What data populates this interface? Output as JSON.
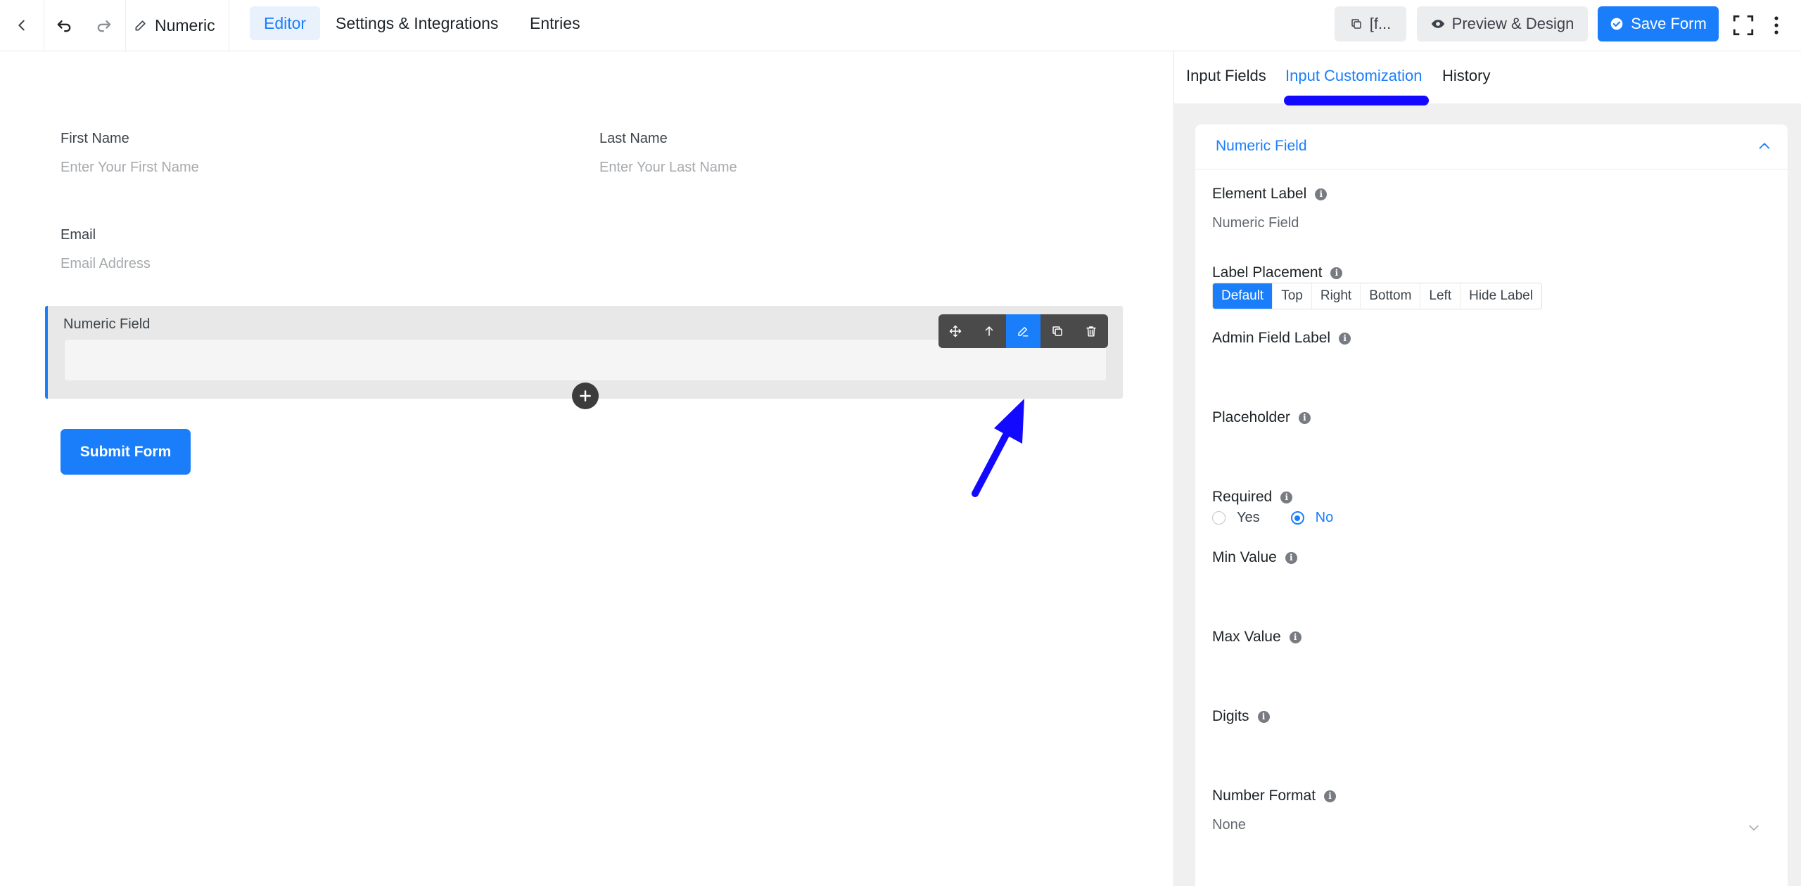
{
  "header": {
    "form_title": "Numeric",
    "tabs": [
      "Editor",
      "Settings & Integrations",
      "Entries"
    ],
    "shortcode_label": "[f...",
    "preview_label": "Preview & Design",
    "save_label": "Save Form"
  },
  "editor": {
    "first_name": {
      "label": "First Name",
      "placeholder": "Enter Your First Name"
    },
    "last_name": {
      "label": "Last Name",
      "placeholder": "Enter Your Last Name"
    },
    "email": {
      "label": "Email",
      "placeholder": "Email Address"
    },
    "numeric": {
      "label": "Numeric Field"
    },
    "submit_label": "Submit Form",
    "toolbar_icons": [
      "move-icon",
      "arrow-up-icon",
      "pencil-icon",
      "copy-icon",
      "trash-icon"
    ],
    "accent_color": "#1a7efb",
    "arrow_color": "#1409ff"
  },
  "panel": {
    "tabs": [
      "Input Fields",
      "Input Customization",
      "History"
    ],
    "active_tab": "Input Customization",
    "section_title": "Numeric Field",
    "element_label": {
      "label": "Element Label",
      "value": "Numeric Field"
    },
    "label_placement": {
      "label": "Label Placement",
      "options": [
        "Default",
        "Top",
        "Right",
        "Bottom",
        "Left",
        "Hide Label"
      ],
      "selected": "Default"
    },
    "admin_field_label": "Admin Field Label",
    "placeholder": "Placeholder",
    "required": {
      "label": "Required",
      "yes": "Yes",
      "no": "No",
      "selected": "No"
    },
    "min_value": "Min Value",
    "max_value": "Max Value",
    "digits": "Digits",
    "number_format": {
      "label": "Number Format",
      "value": "None"
    }
  }
}
